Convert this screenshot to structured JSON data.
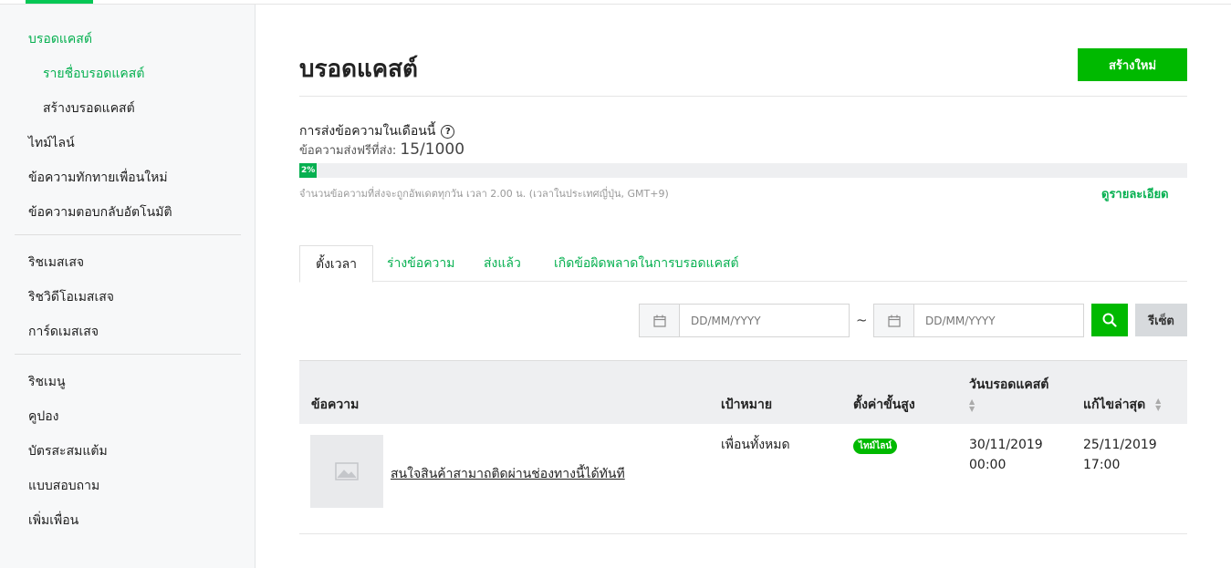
{
  "sidebar": {
    "items": [
      {
        "label": "บรอดแคสต์"
      },
      {
        "label": "รายชื่อบรอดแคสต์"
      },
      {
        "label": "สร้างบรอดแคสต์"
      },
      {
        "label": "ไทม์ไลน์"
      },
      {
        "label": "ข้อความทักทายเพื่อนใหม่"
      },
      {
        "label": "ข้อความตอบกลับอัตโนมัติ"
      },
      {
        "label": "ริชเมสเสจ"
      },
      {
        "label": "ริชวิดีโอเมสเสจ"
      },
      {
        "label": "การ์ดเมสเสจ"
      },
      {
        "label": "ริชเมนู"
      },
      {
        "label": "คูปอง"
      },
      {
        "label": "บัตรสะสมแต้ม"
      },
      {
        "label": "แบบสอบถาม"
      },
      {
        "label": "เพิ่มเพื่อน"
      }
    ]
  },
  "header": {
    "title": "บรอดแคสต์",
    "create_label": "สร้างใหม่"
  },
  "usage": {
    "title": "การส่งข้อความในเดือนนี้",
    "help_glyph": "?",
    "free_label": "ข้อความส่งฟรีที่ส่ง:",
    "free_count": "15/1000",
    "percent_label": "2%",
    "percent_value": 2,
    "note": "จำนวนข้อความที่ส่งจะถูกอัพเดตทุกวัน เวลา 2.00 น. (เวลาในประเทศญี่ปุ่น, GMT+9)",
    "detail_link": "ดูรายละเอียด"
  },
  "tabs": [
    {
      "label": "ตั้งเวลา"
    },
    {
      "label": "ร่างข้อความ"
    },
    {
      "label": "ส่งแล้ว"
    },
    {
      "label": "เกิดข้อผิดพลาดในการบรอดแคสต์"
    }
  ],
  "filter": {
    "start_placeholder": "DD/MM/YYYY",
    "end_placeholder": "DD/MM/YYYY",
    "separator": "~",
    "reset_label": "รีเซ็ต"
  },
  "table": {
    "columns": {
      "message": "ข้อความ",
      "target": "เป้าหมาย",
      "advanced": "ตั้งค่าขั้นสูง",
      "broadcast_date": "วันบรอดแคสต์",
      "last_edited": "แก้ไขล่าสุด"
    },
    "rows": [
      {
        "message": "สนใจสินค้าสามาถติดผ่านช่องทางนี้ได้ทันที",
        "target": "เพื่อนทั้งหมด",
        "badge": "ไทม์ไลน์",
        "broadcast_date": "30/11/2019",
        "broadcast_time": "00:00",
        "edited_date": "25/11/2019",
        "edited_time": "17:00"
      }
    ]
  },
  "colors": {
    "accent": "#06c755",
    "button": "#00b900"
  }
}
